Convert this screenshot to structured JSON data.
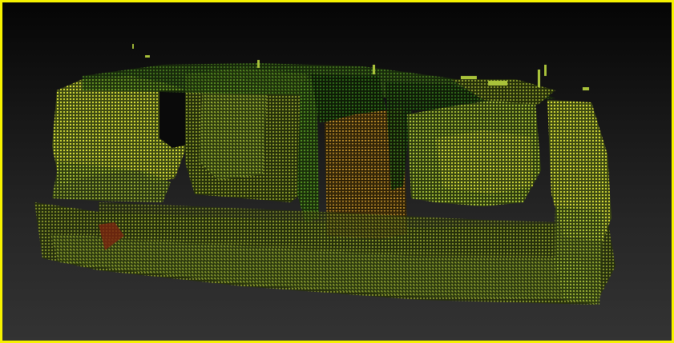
{
  "viewer": {
    "border_color": "#f6f200",
    "background_top": "#050505",
    "background_bottom": "#333333"
  },
  "point_cloud": {
    "palette": {
      "yellow": "#d6dc3a",
      "yellow_green": "#a9c23a",
      "olive": "#8a9a2c",
      "green": "#4f8a22",
      "dark_green": "#2f6a1a",
      "orange": "#b88a2a",
      "red": "#8a2a10"
    }
  }
}
